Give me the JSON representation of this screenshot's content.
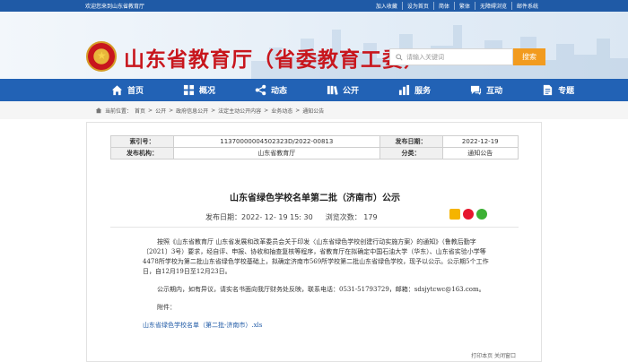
{
  "topbar": {
    "welcome": "欢迎您来到山东省教育厅",
    "links": [
      "加入收藏",
      "设为首页",
      "简体",
      "繁体",
      "无障碍浏览",
      "邮件系统"
    ]
  },
  "header": {
    "title": "山东省教育厅（省委教育工委）",
    "search_placeholder": "请输入关键词",
    "search_button": "搜索"
  },
  "nav": {
    "items": [
      {
        "label": "首页",
        "icon": "home-icon"
      },
      {
        "label": "概况",
        "icon": "grid-icon"
      },
      {
        "label": "动态",
        "icon": "share-icon"
      },
      {
        "label": "公开",
        "icon": "book-icon"
      },
      {
        "label": "服务",
        "icon": "bars-icon"
      },
      {
        "label": "互动",
        "icon": "chat-icon"
      },
      {
        "label": "专题",
        "icon": "doc-icon"
      }
    ]
  },
  "breadcrumb": {
    "prefix": "当前位置：",
    "path": [
      "首页",
      "公开",
      "政府信息公开",
      "法定主动公开内容",
      "业务动态",
      "通知公告"
    ]
  },
  "meta": {
    "index_label": "索引号：",
    "index_value": "11370000004502323D/2022-00813",
    "date_label": "发布日期：",
    "date_value": "2022-12-19",
    "org_label": "发布机构：",
    "org_value": "山东省教育厅",
    "cat_label": "分类：",
    "cat_value": "通知公告"
  },
  "article": {
    "title": "山东省绿色学校名单第二批（济南市）公示",
    "pub_time_label": "发布日期：",
    "pub_time": "2022- 12- 19 15: 30",
    "views_label": "浏览次数：",
    "views": "179",
    "para1": "按照《山东省教育厅  山东省发展和改革委员会关于印发〈山东省绿色学校创建行动实施方案〉的通知》（鲁教后勤字〔2021〕3号）要求，经自评、申报、协收和抽查复核等程序，省教育厅在拟确定中国石油大学（华东）、山东省实验小学等4478所学校为第二批山东省绿色学校基础上，拟确定济南市569所学校第二批山东省绿色学校，现予以公示。公示期5个工作日，自12月19日至12月23日。",
    "para2": "公示期内，如有异议，请实名书面向我厅财务处反映，联系电话：0531-51793729，邮箱：sdsjytcwc@163.com。",
    "attach_label": "附件：",
    "attachment": "山东省绿色学校名单（第二批-济南市）.xls"
  },
  "footer": {
    "actions": "打印本页  关闭窗口"
  },
  "colors": {
    "brand_blue": "#2262b5",
    "title_red": "#c8161d",
    "search_orange": "#f29b1f"
  }
}
